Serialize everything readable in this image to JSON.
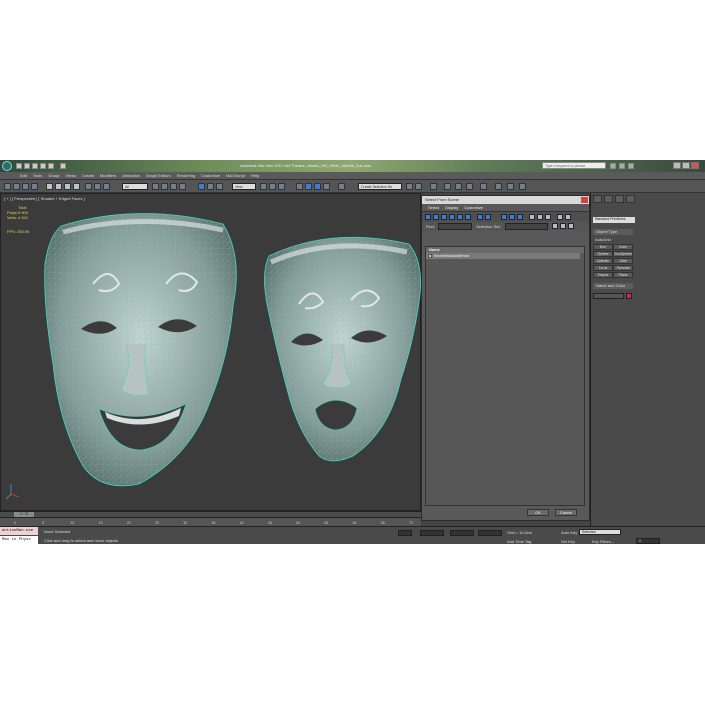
{
  "window": {
    "title": "Autodesk 3ds Max 2011 x64    Theatre_Masks_Set_White_Marble_3ds.max",
    "search_placeholder": "Type a keyword or phrase"
  },
  "menu": [
    "Edit",
    "Tools",
    "Group",
    "Views",
    "Create",
    "Modifiers",
    "Animation",
    "Graph Editors",
    "Rendering",
    "Customize",
    "MAXScript",
    "Help"
  ],
  "toolbar": {
    "filter_value": "All",
    "refcoord_value": "View",
    "selection_set": "Create Selection Se"
  },
  "viewport": {
    "label": "[ + ] [ Perspective ] [ Shaded + Edged Faces ]",
    "stats_header": "Total",
    "polys_label": "Polys:",
    "polys_value": "9 900",
    "verts_label": "Verts:",
    "verts_value": "4 942",
    "fps_label": "FPS:",
    "fps_value": "255.90"
  },
  "timeslider": {
    "frame": "0 / 70",
    "ticks": [
      "0",
      "5",
      "10",
      "15",
      "20",
      "25",
      "30",
      "35",
      "40",
      "45",
      "50",
      "55",
      "60",
      "65",
      "70"
    ]
  },
  "dialog": {
    "title": "Select From Scene",
    "menu": [
      "Select",
      "Display",
      "Customize"
    ],
    "find_label": "Find:",
    "selection_set_label": "Selection Set:",
    "column_header": "Name",
    "items": [
      "theatreMasksMrmar"
    ],
    "ok": "OK",
    "cancel": "Cancel"
  },
  "command_panel": {
    "category": "Standard Primitives",
    "object_type": "Object Type",
    "autogrid": "AutoGrid",
    "buttons": [
      "Box",
      "Cone",
      "Sphere",
      "GeoSphere",
      "Cylinder",
      "Tube",
      "Torus",
      "Pyramid",
      "Teapot",
      "Plane"
    ],
    "name_and_color": "Name and Color",
    "swatch_color": "#d81c7c"
  },
  "status": {
    "script_text": "actionMan.exe",
    "welcome": "Max to Physx",
    "selection": "None Selected",
    "hint": "Click and drag to select and move objects",
    "grid": "Grid = 10,0cm",
    "auto_key": "Auto Key",
    "set_key": "Set Key",
    "selected": "Selected",
    "key_filters": "Key Filters...",
    "add_time_tag": "Add Time Tag",
    "frame_value": "0"
  }
}
